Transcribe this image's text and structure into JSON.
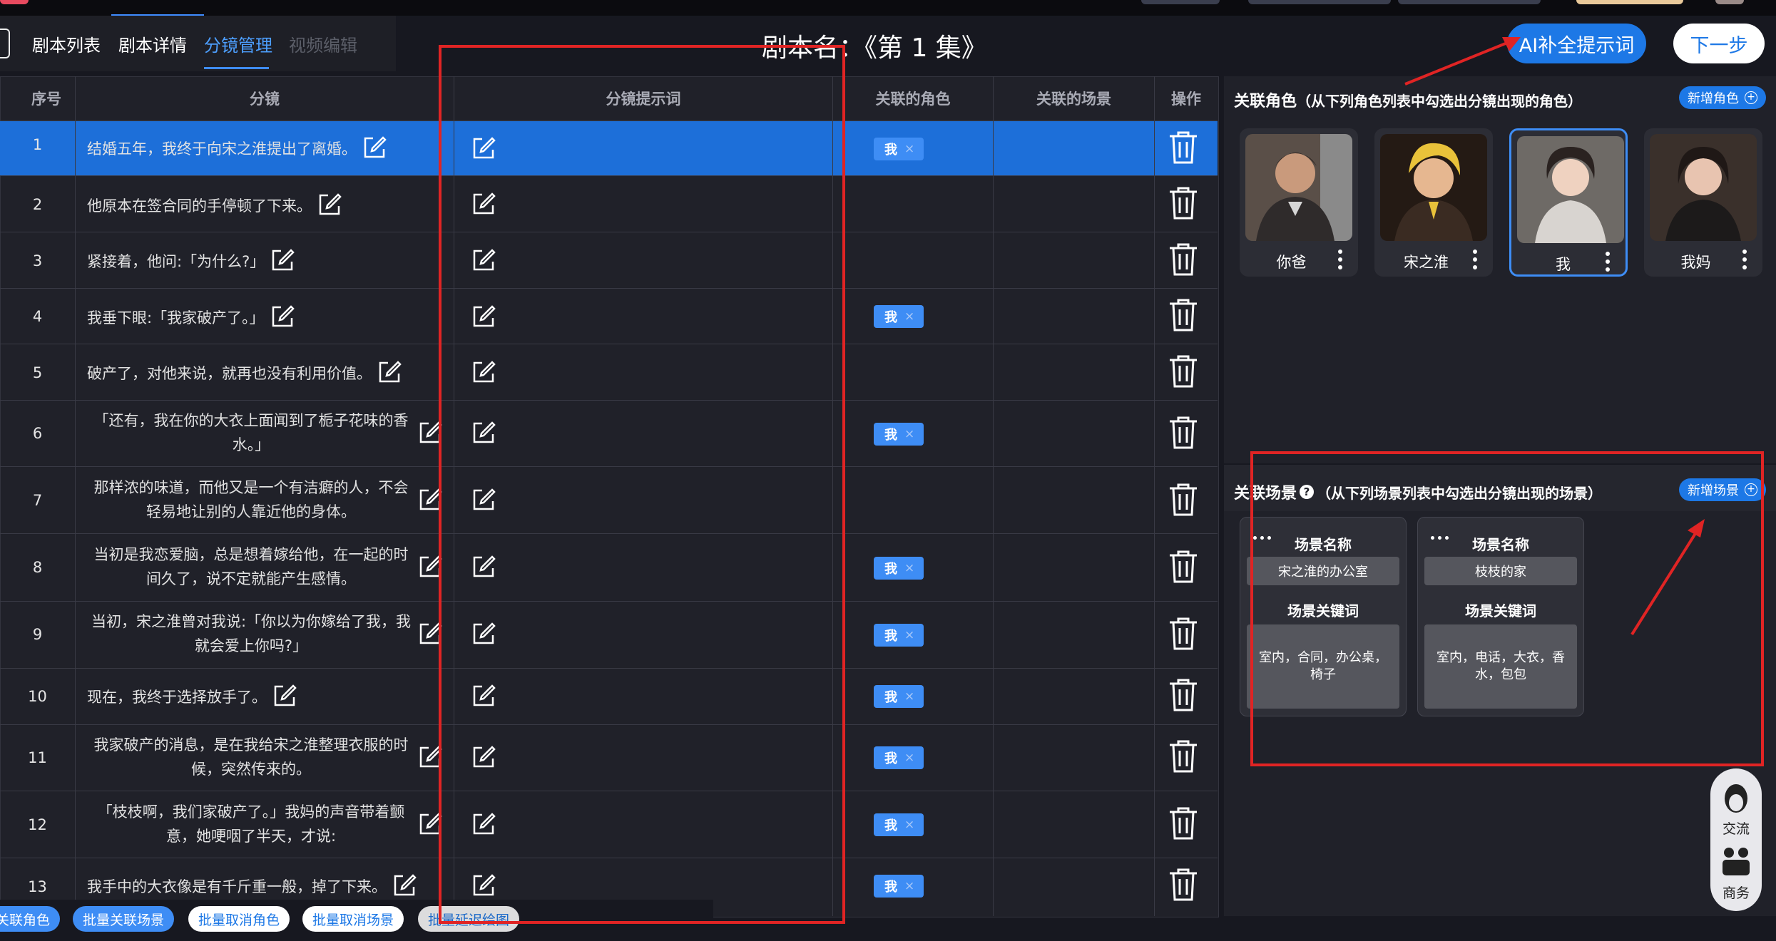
{
  "nav": {
    "tabs": [
      {
        "label": "剧本列表",
        "state": "normal"
      },
      {
        "label": "剧本详情",
        "state": "normal"
      },
      {
        "label": "分镜管理",
        "state": "active"
      },
      {
        "label": "视频编辑",
        "state": "disabled"
      }
    ]
  },
  "header": {
    "script_title": "剧本名：《第 1 集》",
    "ai_button": "AI补全提示词",
    "next_button": "下一步"
  },
  "table": {
    "columns": [
      "序号",
      "分镜",
      "分镜提示词",
      "关联的角色",
      "关联的场景",
      "操作"
    ],
    "tag_label": "我",
    "tag_close": "×",
    "rows": [
      {
        "num": "1",
        "text": "结婚五年，我终于向宋之淮提出了离婚。",
        "role": true,
        "selected": true
      },
      {
        "num": "2",
        "text": "他原本在签合同的手停顿了下来。",
        "role": false
      },
      {
        "num": "3",
        "text": "紧接着，他问:「为什么?」",
        "role": false
      },
      {
        "num": "4",
        "text": "我垂下眼:「我家破产了。」",
        "role": true
      },
      {
        "num": "5",
        "text": "破产了，对他来说，就再也没有利用价值。",
        "role": false
      },
      {
        "num": "6",
        "line1": "「还有，我在你的大衣上面闻到了栀子花味的香",
        "line2": "水。」",
        "role": true
      },
      {
        "num": "7",
        "line1": "那样浓的味道，而他又是一个有洁癖的人，不会",
        "line2": "轻易地让别的人靠近他的身体。",
        "role": false
      },
      {
        "num": "8",
        "line1": "当初是我恋爱脑，总是想着嫁给他，在一起的时",
        "line2": "间久了，说不定就能产生感情。",
        "role": true
      },
      {
        "num": "9",
        "line1": "当初，宋之淮曾对我说:「你以为你嫁给了我，我",
        "line2": "就会爱上你吗?」",
        "role": true
      },
      {
        "num": "10",
        "text": "现在，我终于选择放手了。",
        "role": true
      },
      {
        "num": "11",
        "line1": "我家破产的消息，是在我给宋之淮整理衣服的时",
        "line2": "候，突然传来的。",
        "role": true
      },
      {
        "num": "12",
        "line1": "「枝枝啊，我们家破产了。」我妈的声音带着颤",
        "line2": "意，她哽咽了半天，才说:",
        "role": true
      },
      {
        "num": "13",
        "text": "我手中的大衣像是有千斤重一般，掉了下来。",
        "role": true
      }
    ]
  },
  "bottom_buttons": [
    "关联角色",
    "批量关联场景",
    "批量取消角色",
    "批量取消场景",
    "批量延迟绘图"
  ],
  "roles_panel": {
    "title": "关联角色",
    "subtitle": "（从下列角色列表中勾选出分镜出现的角色）",
    "add_button": "新增角色",
    "characters": [
      {
        "name": "你爸",
        "selected": false
      },
      {
        "name": "宋之淮",
        "selected": false
      },
      {
        "name": "我",
        "selected": true
      },
      {
        "name": "我妈",
        "selected": false
      }
    ]
  },
  "scenes_panel": {
    "title": "关联场景",
    "help_icon": "?",
    "subtitle": "（从下列场景列表中勾选出分镜出现的场景）",
    "add_button": "新增场景",
    "name_label": "场景名称",
    "keyword_label": "场景关键词",
    "scenes": [
      {
        "name": "宋之淮的办公室",
        "keywords": "室内，合同，办公桌，椅子"
      },
      {
        "name": "枝枝的家",
        "keywords": "室内，电话，大衣，香水，包包"
      }
    ]
  },
  "side_widget": {
    "top_label": "交流",
    "bottom_label": "商务"
  },
  "colors": {
    "accent": "#1d78e6",
    "selected_row": "#1d6fd9",
    "annotation": "#e02424"
  }
}
